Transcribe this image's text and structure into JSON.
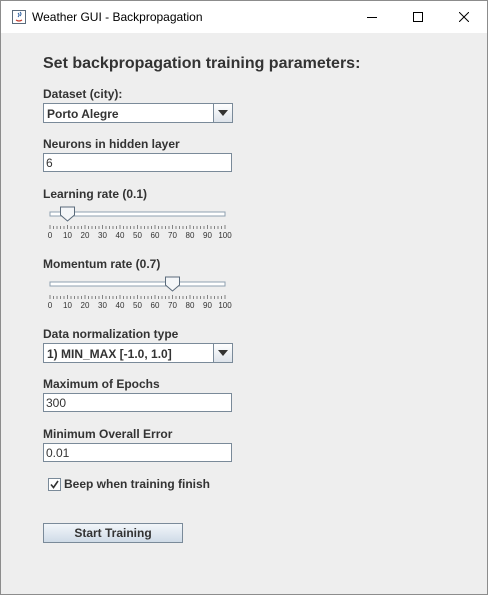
{
  "window": {
    "title": "Weather GUI - Backpropagation",
    "controls": [
      "minimize-icon",
      "maximize-icon",
      "close-icon"
    ]
  },
  "form": {
    "heading": "Set backpropagation training parameters:",
    "dataset": {
      "label": "Dataset (city):",
      "value": "Porto Alegre"
    },
    "neurons": {
      "label": "Neurons in hidden layer",
      "value": "6"
    },
    "learning_rate": {
      "label": "Learning rate (0.1)",
      "value": 10,
      "ticks": [
        "0",
        "10",
        "20",
        "30",
        "40",
        "50",
        "60",
        "70",
        "80",
        "90",
        "100"
      ]
    },
    "momentum_rate": {
      "label": "Momentum rate (0.7)",
      "value": 70,
      "ticks": [
        "0",
        "10",
        "20",
        "30",
        "40",
        "50",
        "60",
        "70",
        "80",
        "90",
        "100"
      ]
    },
    "normalization": {
      "label": "Data normalization type",
      "value": "1) MIN_MAX [-1.0, 1.0]"
    },
    "max_epochs": {
      "label": "Maximum of Epochs",
      "value": "300"
    },
    "min_error": {
      "label": "Minimum Overall Error",
      "value": "0.01"
    },
    "beep": {
      "label": "Beep when training finish",
      "checked": true
    },
    "start_button": "Start Training"
  },
  "colors": {
    "background": "#eeeeee",
    "text": "#333333",
    "border": "#7a8a99"
  }
}
